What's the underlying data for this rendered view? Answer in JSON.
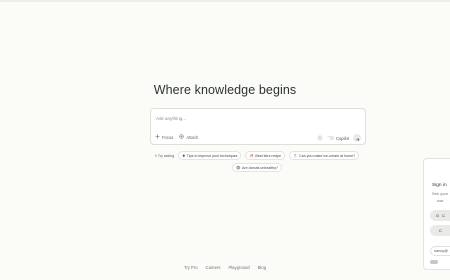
{
  "title": "Where knowledge begins",
  "search": {
    "placeholder": "Ask anything...",
    "value": "",
    "focus_label": "Focus",
    "attach_label": "Attach",
    "copilot_label": "Copilot"
  },
  "suggestions": {
    "try_label": "Try asking",
    "items": [
      {
        "icon": "✹",
        "label": "Tips to improve pool techniques"
      },
      {
        "icon": "🍜",
        "label": "Best tiers recipe"
      },
      {
        "icon": "🧂",
        "label": "Can you make ice-cream at home?"
      },
      {
        "icon": "👁",
        "label": "Are donuts unhealthy?"
      }
    ]
  },
  "signin": {
    "heading_partial": "Sign in",
    "line2_partial": "See your",
    "line3_partial": "use",
    "google_partial": "C",
    "apple_partial": "C",
    "email_partial": "nancy@"
  },
  "footer": [
    "Try Pro",
    "Careers",
    "Playground",
    "Blog"
  ]
}
